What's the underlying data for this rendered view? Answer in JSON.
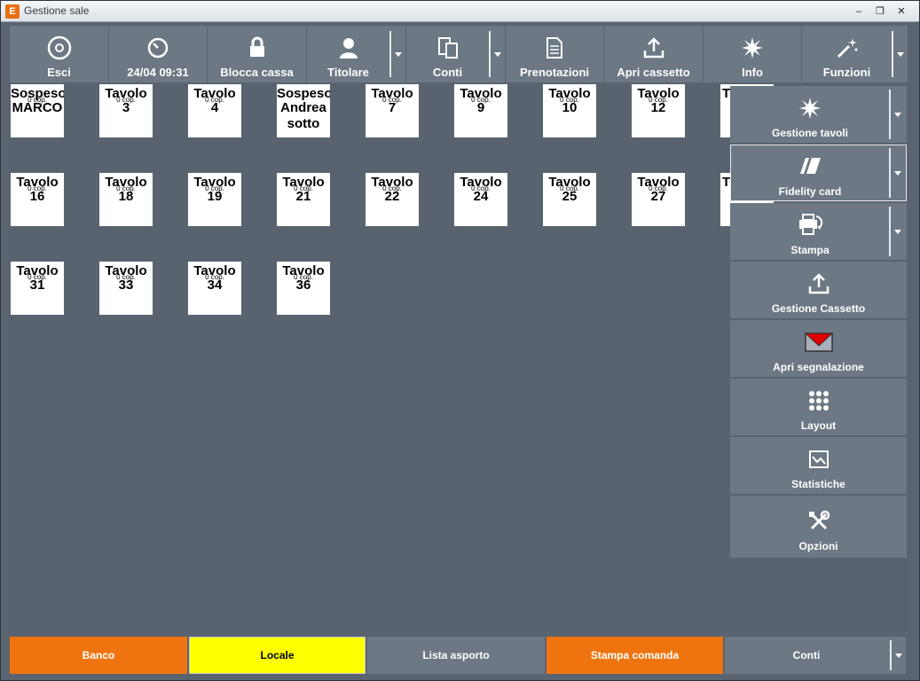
{
  "window": {
    "app_icon_letter": "E",
    "title": "Gestione sale",
    "minimize": "‒",
    "restore": "❐",
    "close": "✕"
  },
  "toolbar": [
    {
      "label": "Esci",
      "icon": "power-icon"
    },
    {
      "label": "24/04 09:31",
      "icon": "clock-icon"
    },
    {
      "label": "Blocca cassa",
      "icon": "lock-icon"
    },
    {
      "label": "Titolare",
      "icon": "user-icon",
      "dropdown": true
    },
    {
      "label": "Conti",
      "icon": "documents-icon",
      "dropdown": true
    },
    {
      "label": "Prenotazioni",
      "icon": "document-icon"
    },
    {
      "label": "Apri cassetto",
      "icon": "upload-icon"
    },
    {
      "label": "Info",
      "icon": "starburst-icon"
    },
    {
      "label": "Funzioni",
      "icon": "magic-wand-icon",
      "dropdown": true
    }
  ],
  "tables": [
    {
      "title": "Sospeso",
      "sub": "MARCO",
      "cop": "0 cop."
    },
    {
      "title": "Tavolo",
      "sub": "3",
      "cop": "0 cop."
    },
    {
      "title": "Tavolo",
      "sub": "4",
      "cop": "0 cop."
    },
    {
      "title": "Sospeso",
      "sub": "Andrea",
      "sub2": "sotto",
      "cop": ""
    },
    {
      "title": "Tavolo",
      "sub": "7",
      "cop": "0 cop."
    },
    {
      "title": "Tavolo",
      "sub": "9",
      "cop": "0 cop."
    },
    {
      "title": "Tavolo",
      "sub": "10",
      "cop": "0 cop."
    },
    {
      "title": "Tavolo",
      "sub": "12",
      "cop": "0 cop."
    },
    {
      "title": "T",
      "sub": "",
      "cop": ""
    },
    {
      "title": "Tavolo",
      "sub": "16",
      "cop": "0 cop."
    },
    {
      "title": "Tavolo",
      "sub": "18",
      "cop": "0 cop."
    },
    {
      "title": "Tavolo",
      "sub": "19",
      "cop": "0 cop."
    },
    {
      "title": "Tavolo",
      "sub": "21",
      "cop": "0 cop."
    },
    {
      "title": "Tavolo",
      "sub": "22",
      "cop": "0 cop."
    },
    {
      "title": "Tavolo",
      "sub": "24",
      "cop": "0 cop."
    },
    {
      "title": "Tavolo",
      "sub": "25",
      "cop": "0 cop."
    },
    {
      "title": "Tavolo",
      "sub": "27",
      "cop": "0 cop."
    },
    {
      "title": "T",
      "sub": "",
      "cop": ""
    },
    {
      "title": "Tavolo",
      "sub": "31",
      "cop": "0 cop."
    },
    {
      "title": "Tavolo",
      "sub": "33",
      "cop": "0 cop."
    },
    {
      "title": "Tavolo",
      "sub": "34",
      "cop": "0 cop."
    },
    {
      "title": "Tavolo",
      "sub": "36",
      "cop": "0 cop."
    }
  ],
  "side_menu": [
    {
      "label": "Gestione tavoli",
      "icon": "starburst-icon",
      "dropdown": true
    },
    {
      "label": "Fidelity card",
      "icon": "cards-icon",
      "dropdown": true,
      "selected": true
    },
    {
      "label": "Stampa",
      "icon": "printer-icon",
      "dropdown": true
    },
    {
      "label": "Gestione Cassetto",
      "icon": "upload-icon"
    },
    {
      "label": "Apri segnalazione",
      "icon": "envelope-icon"
    },
    {
      "label": "Layout",
      "icon": "grid-icon"
    },
    {
      "label": "Statistiche",
      "icon": "chart-icon"
    },
    {
      "label": "Opzioni",
      "icon": "tools-icon"
    }
  ],
  "bottom": [
    {
      "label": "Banco",
      "style": "orange"
    },
    {
      "label": "Locale",
      "style": "yellow"
    },
    {
      "label": "Lista asporto",
      "style": "grey"
    },
    {
      "label": "Stampa comanda",
      "style": "orange"
    },
    {
      "label": "Conti",
      "style": "grey",
      "dropdown": true
    }
  ],
  "colors": {
    "accent_orange": "#ef7410",
    "selected_yellow": "#ffff00",
    "button_grey": "#6c7884",
    "background": "#59636f"
  }
}
